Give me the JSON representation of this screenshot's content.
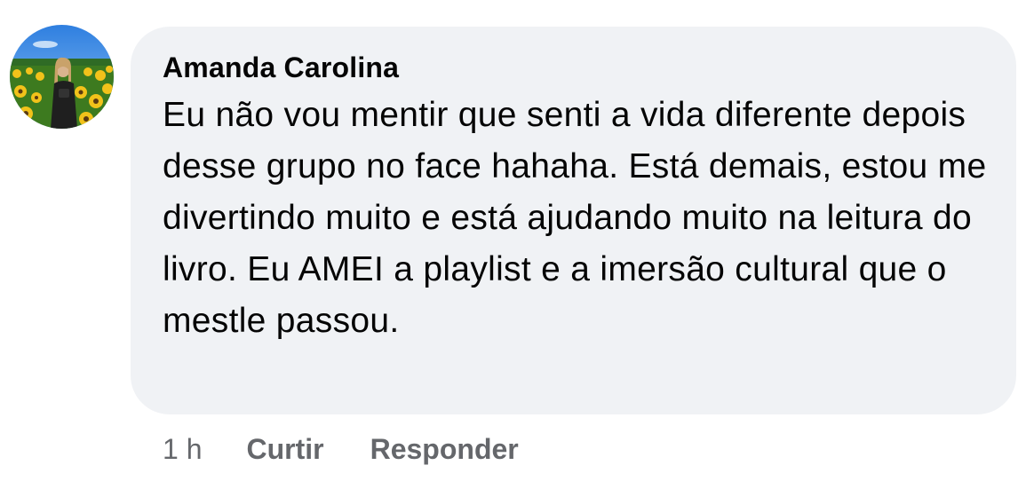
{
  "comment": {
    "author": "Amanda Carolina",
    "text": "Eu não vou mentir que senti a vida diferente depois desse grupo no face hahaha. Está demais, estou me divertindo muito e está ajudando muito na leitura do livro. Eu AMEI a playlist e a imersão cultural que o mestle passou.",
    "avatar_icon": "profile-photo-sunflower-field",
    "timestamp": "1 h",
    "actions": {
      "like_label": "Curtir",
      "reply_label": "Responder"
    }
  },
  "colors": {
    "bubble_background": "#f0f2f5",
    "text_primary": "#050505",
    "text_secondary": "#65676b"
  }
}
